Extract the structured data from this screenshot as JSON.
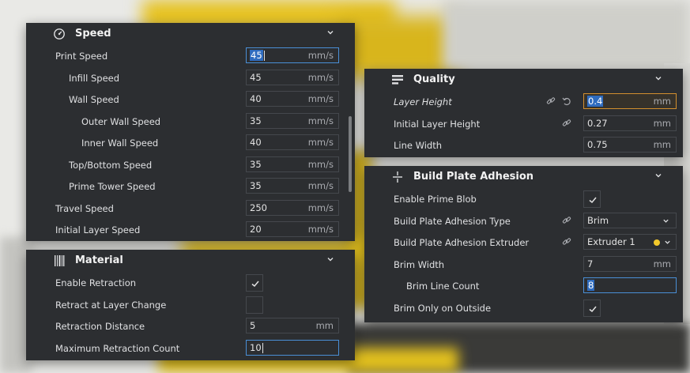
{
  "colors": {
    "panel_bg": "#2c2e31",
    "field_border": "#45484d",
    "focus_border": "#4a8fd6",
    "warn_border": "#d28f2e",
    "extruder_dot": "#f3c92b",
    "text": "#dfe0e2"
  },
  "speed": {
    "title": "Speed",
    "icon": "speedometer-icon",
    "rows": [
      {
        "label": "Print Speed",
        "value": "45",
        "unit": "mm/s",
        "state": "focused"
      },
      {
        "label": "Infill Speed",
        "value": "45",
        "unit": "mm/s"
      },
      {
        "label": "Wall Speed",
        "value": "40",
        "unit": "mm/s"
      },
      {
        "label": "Outer Wall Speed",
        "value": "35",
        "unit": "mm/s"
      },
      {
        "label": "Inner Wall Speed",
        "value": "40",
        "unit": "mm/s"
      },
      {
        "label": "Top/Bottom Speed",
        "value": "35",
        "unit": "mm/s"
      },
      {
        "label": "Prime Tower Speed",
        "value": "35",
        "unit": "mm/s"
      },
      {
        "label": "Travel Speed",
        "value": "250",
        "unit": "mm/s"
      },
      {
        "label": "Initial Layer Speed",
        "value": "20",
        "unit": "mm/s"
      }
    ]
  },
  "material": {
    "title": "Material",
    "icon": "barcode-icon",
    "rows": [
      {
        "label": "Enable Retraction",
        "checked": true
      },
      {
        "label": "Retract at Layer Change",
        "checked": false
      },
      {
        "label": "Retraction Distance",
        "value": "5",
        "unit": "mm"
      },
      {
        "label": "Maximum Retraction Count",
        "value": "10",
        "state": "focused"
      }
    ]
  },
  "quality": {
    "title": "Quality",
    "icon": "quality-icon",
    "rows": [
      {
        "label": "Layer Height",
        "value": "0.4",
        "unit": "mm",
        "state": "warning"
      },
      {
        "label": "Initial Layer Height",
        "value": "0.27",
        "unit": "mm"
      },
      {
        "label": "Line Width",
        "value": "0.75",
        "unit": "mm"
      }
    ]
  },
  "adhesion": {
    "title": "Build Plate Adhesion",
    "icon": "build-plate-icon",
    "rows": [
      {
        "label": "Enable Prime Blob",
        "checked": true
      },
      {
        "label": "Build Plate Adhesion Type",
        "value": "Brim"
      },
      {
        "label": "Build Plate Adhesion Extruder",
        "value": "Extruder 1"
      },
      {
        "label": "Brim Width",
        "value": "7",
        "unit": "mm"
      },
      {
        "label": "Brim Line Count",
        "value": "8",
        "state": "focused"
      },
      {
        "label": "Brim Only on Outside",
        "checked": true
      }
    ]
  }
}
